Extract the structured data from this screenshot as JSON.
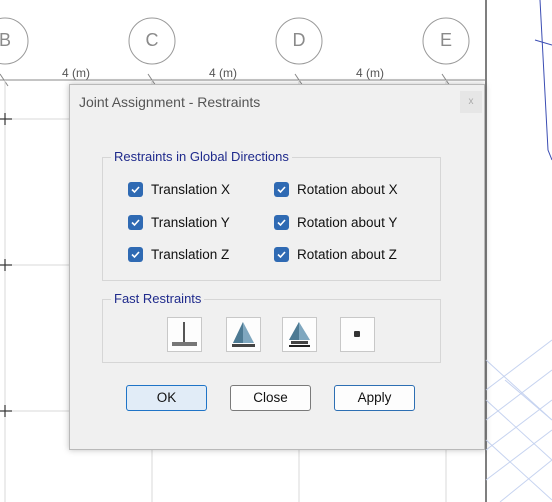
{
  "background": {
    "grid_bubbles": [
      "B",
      "C",
      "D",
      "E"
    ],
    "dimensions": [
      "4 (m)",
      "4 (m)",
      "4 (m)"
    ]
  },
  "dialog": {
    "title": "Joint Assignment - Restraints",
    "close_glyph": "x",
    "restraints_group": {
      "caption": "Restraints in Global Directions",
      "items": [
        {
          "label": "Translation  X",
          "checked": true
        },
        {
          "label": "Rotation about  X",
          "checked": true
        },
        {
          "label": "Translation  Y",
          "checked": true
        },
        {
          "label": "Rotation about  Y",
          "checked": true
        },
        {
          "label": "Translation  Z",
          "checked": true
        },
        {
          "label": "Rotation about  Z",
          "checked": true
        }
      ]
    },
    "fast_group": {
      "caption": "Fast Restraints",
      "buttons": [
        "fixed-support-icon",
        "pinned-support-icon",
        "roller-support-icon",
        "free-joint-icon"
      ]
    },
    "buttons": {
      "ok": "OK",
      "close": "Close",
      "apply": "Apply"
    }
  },
  "colors": {
    "checkbox": "#2f6ab3",
    "group_caption": "#1f2a8c",
    "ok_border": "#1f74c7"
  }
}
